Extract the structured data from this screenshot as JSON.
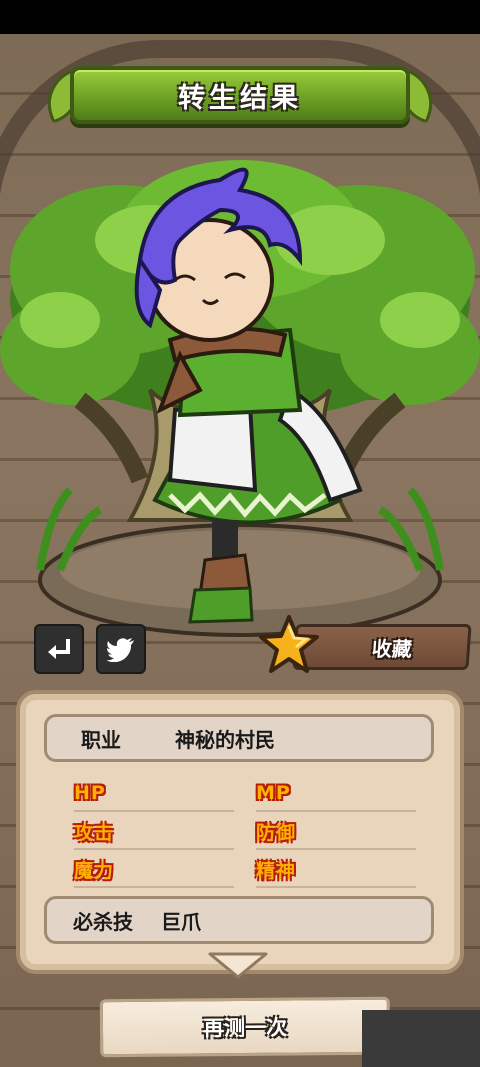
{
  "header": {
    "title": "转生结果"
  },
  "actions": {
    "back_icon": "return-arrow-icon",
    "share_icon": "twitter-bird-icon",
    "favorite_label": "收藏",
    "favorite_icon": "star-icon"
  },
  "result": {
    "class_label": "职业",
    "class_value": "神秘的村民",
    "stats": {
      "hp": "HP",
      "mp": "MP",
      "attack": "攻击",
      "defense": "防御",
      "magic": "魔力",
      "spirit": "精神"
    },
    "skill_label": "必杀技",
    "skill_value": "巨爪"
  },
  "footer": {
    "retry_label": "再测一次"
  },
  "colors": {
    "banner_green": "#6da225",
    "stat_label_fill": "#ffb000",
    "stat_label_outline": "#b51d0a",
    "panel_bg": "#e9d5bc"
  }
}
